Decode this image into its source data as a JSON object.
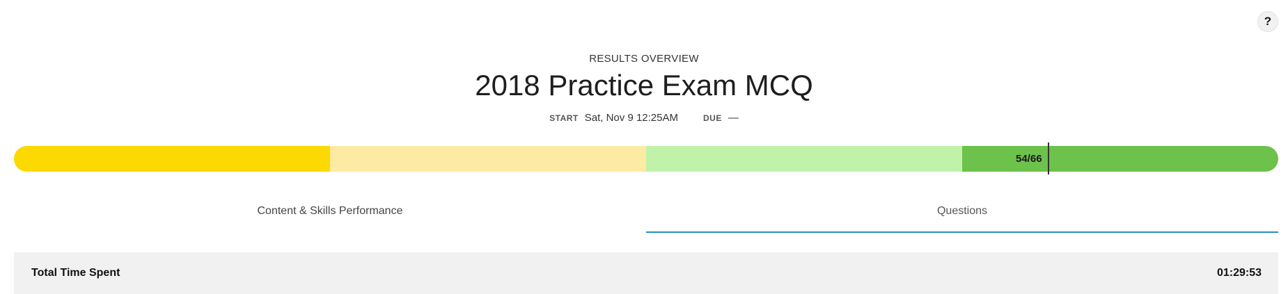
{
  "help": {
    "label": "?"
  },
  "header": {
    "eyebrow": "RESULTS OVERVIEW",
    "title": "2018 Practice Exam MCQ",
    "start_label": "START",
    "start_value": "Sat, Nov 9 12:25AM",
    "due_label": "DUE",
    "due_value": "—"
  },
  "progress": {
    "segments": [
      {
        "color": "#fcd900"
      },
      {
        "color": "#feeba3"
      },
      {
        "color": "#c0f3a9"
      },
      {
        "color": "#6cc24a"
      }
    ],
    "count_label": "54/66",
    "marker_fraction": 0.818
  },
  "tabs": [
    {
      "label": "Content & Skills Performance",
      "active": false
    },
    {
      "label": "Questions",
      "active": true
    }
  ],
  "summary": {
    "total_time_label": "Total Time Spent",
    "total_time_value": "01:29:53"
  }
}
